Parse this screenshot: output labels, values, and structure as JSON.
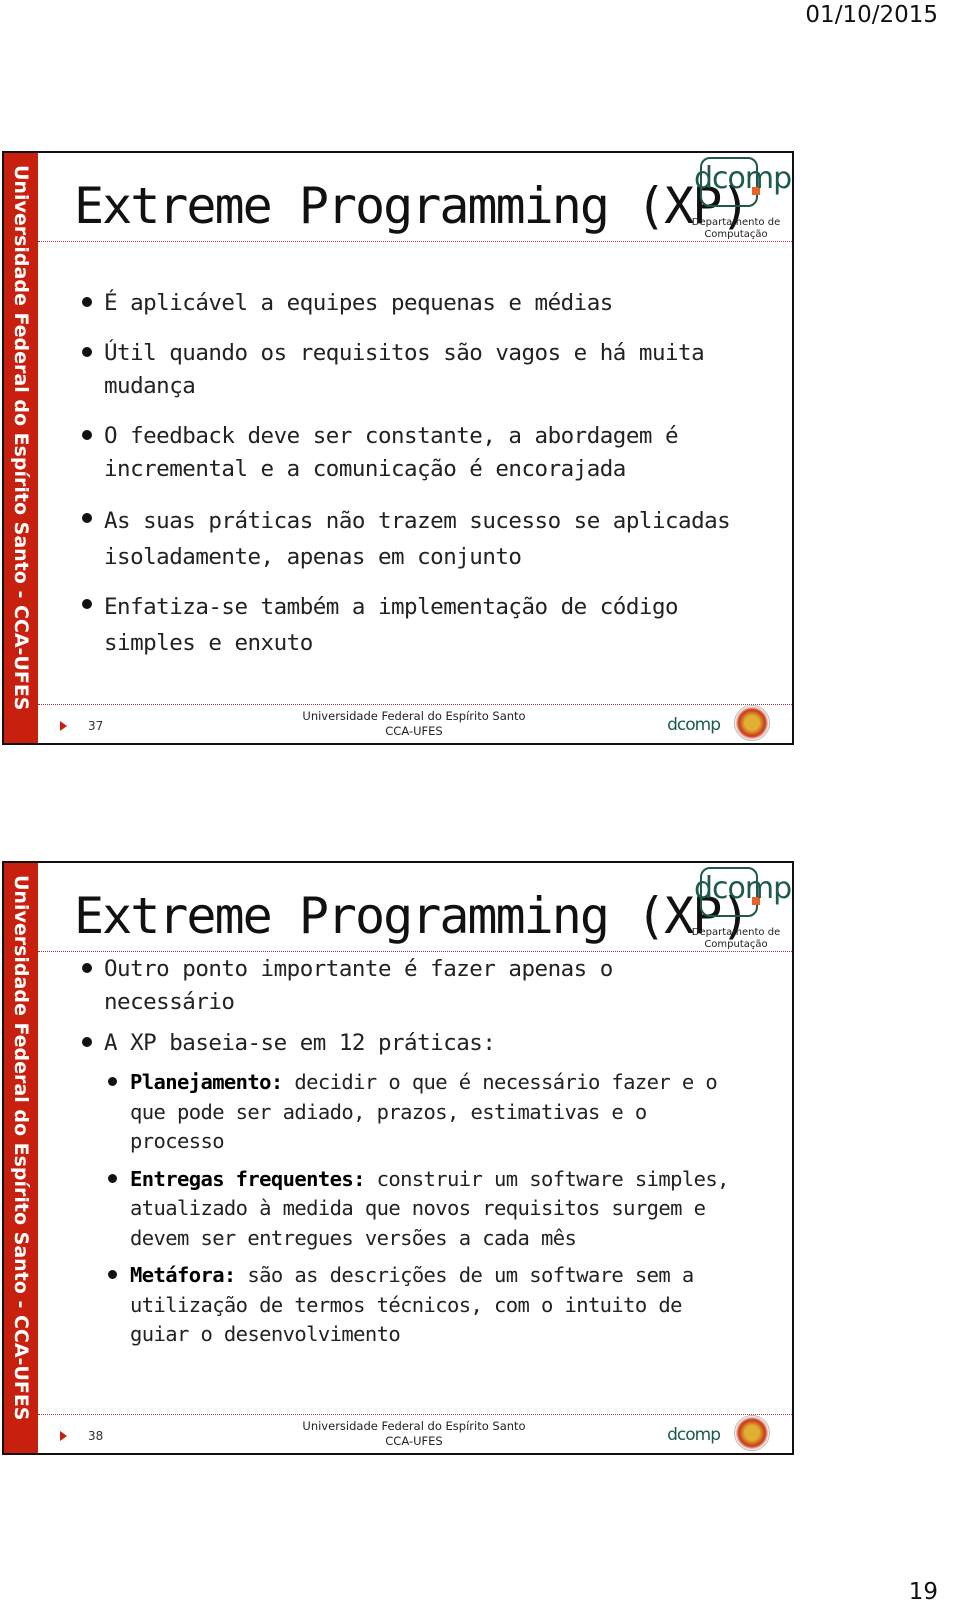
{
  "page": {
    "date": "01/10/2015",
    "page_number": "19"
  },
  "slides": [
    {
      "sidebar_text": "Universidade Federal do Espírito Santo - CCA-UFES",
      "title": "Extreme Programming (XP)",
      "logo": {
        "name": "dcomp",
        "subtitle_line1": "Departamento de",
        "subtitle_line2": "Computação"
      },
      "bullets": [
        "É aplicável a equipes pequenas e médias",
        "Útil quando os requisitos são vagos e há muita mudança",
        "O feedback deve ser constante, a abordagem é incremental e a comunicação é encorajada",
        "As suas práticas não trazem sucesso se aplicadas isoladamente, apenas em conjunto",
        "Enfatiza-se também a implementação de código simples e enxuto"
      ],
      "footer": {
        "slide_number": "37",
        "line1": "Universidade Federal do Espírito Santo",
        "line2": "CCA-UFES",
        "logo": "dcomp"
      }
    },
    {
      "sidebar_text": "Universidade Federal do Espírito Santo - CCA-UFES",
      "title": "Extreme Programming (XP)",
      "logo": {
        "name": "dcomp",
        "subtitle_line1": "Departamento de",
        "subtitle_line2": "Computação"
      },
      "bullets": [
        "Outro ponto importante é fazer apenas o necessário",
        "A XP baseia-se em 12 práticas:"
      ],
      "sub_bullets": [
        {
          "term": "Planejamento:",
          "text": " decidir o que é necessário fazer e o que pode ser adiado, prazos, estimativas e o processo"
        },
        {
          "term": "Entregas frequentes:",
          "text": " construir um software simples, atualizado à medida que novos requisitos surgem e devem ser entregues versões a cada mês"
        },
        {
          "term": "Metáfora:",
          "text": " são as descrições de um software sem a utilização de termos técnicos, com o intuito de guiar o desenvolvimento"
        }
      ],
      "footer": {
        "slide_number": "38",
        "line1": "Universidade Federal do Espírito Santo",
        "line2": "CCA-UFES",
        "logo": "dcomp"
      }
    }
  ]
}
